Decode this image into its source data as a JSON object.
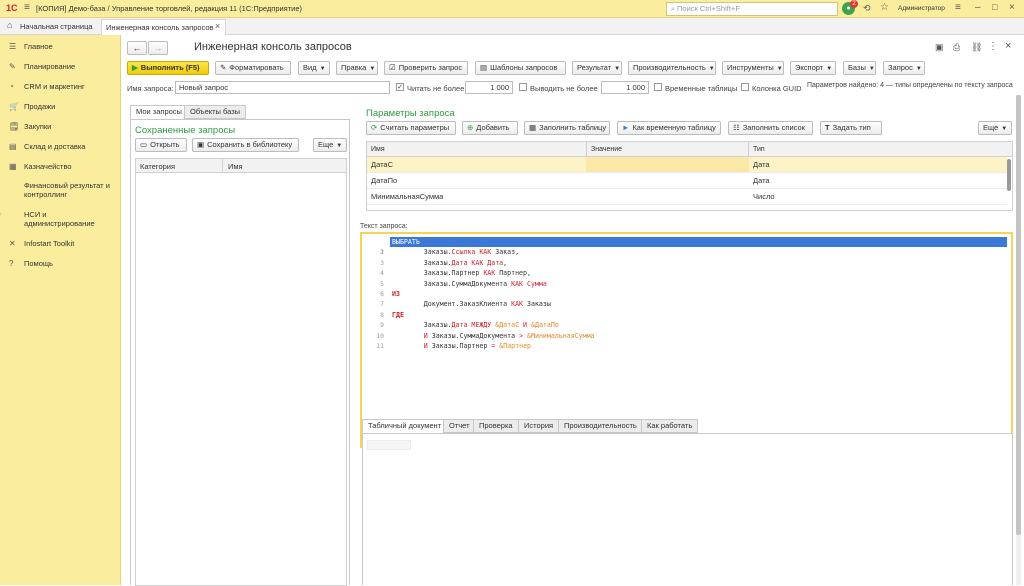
{
  "titlebar": {
    "logo": "1С",
    "title": "[КОПИЯ] Демо-база / Управление торговлей, редакция 11  (1С:Предприятие)",
    "search_placeholder": "Поиск Ctrl+Shift+F",
    "notification_count": "2",
    "user": "Администратор"
  },
  "tabs": {
    "home": "Начальная страница",
    "current": "Инженерная консоль запросов",
    "close": "×"
  },
  "sidebar": {
    "items": [
      {
        "icon": "☰",
        "label": "Главное"
      },
      {
        "icon": "✎",
        "label": "Планирование"
      },
      {
        "icon": "◔",
        "label": "CRM и маркетинг"
      },
      {
        "icon": "🛒",
        "label": "Продажи"
      },
      {
        "icon": "🗒",
        "label": "Закупки"
      },
      {
        "icon": "▤",
        "label": "Склад и доставка"
      },
      {
        "icon": "▦",
        "label": "Казначейство"
      },
      {
        "icon": "▮",
        "label": "Финансовый результат и контроллинг"
      },
      {
        "icon": "⚙",
        "label": "НСИ и администрирование"
      },
      {
        "icon": "✕",
        "label": "Infostart Toolkit"
      },
      {
        "icon": "?",
        "label": "Помощь"
      }
    ]
  },
  "page": {
    "title": "Инженерная консоль запросов",
    "back": "←",
    "forward": "→",
    "more": "⋮",
    "close": "×"
  },
  "toolbar": {
    "run": "Выполнить (F5)",
    "format": "Форматировать",
    "vid": "Вид",
    "pravka": "Правка",
    "check": "Проверить запрос",
    "templates": "Шаблоны запросов",
    "result": "Результат",
    "performance": "Производительность",
    "tools": "Инструменты",
    "export": "Экспорт",
    "bases": "Базы",
    "query": "Запрос"
  },
  "options": {
    "name_label": "Имя запроса:",
    "name_value": "Новый запрос",
    "read_limit_label": "Читать не более",
    "read_limit_value": "1 000",
    "output_limit_label": "Выводить не более",
    "output_limit_value": "1 000",
    "temp_tables_label": "Временные таблицы",
    "guid_label": "Колонка GUID",
    "params_info": "Параметров найдено: 4 — типы определены по тексту запроса"
  },
  "left_panel": {
    "tab_my": "Мои запросы",
    "tab_objects": "Объекты базы",
    "saved_title": "Сохраненные запросы",
    "open": "Открыть",
    "save_lib": "Сохранить в библиотеку",
    "more": "Еще",
    "col_category": "Категория",
    "col_name": "Имя"
  },
  "params": {
    "title": "Параметры запроса",
    "count": "Считать параметры",
    "add": "Добавить",
    "fill_table": "Заполнить таблицу",
    "as_temp": "Как временную таблицу",
    "fill_list": "Заполнить список",
    "set_type": "Задать тип",
    "more": "Еще",
    "col_name": "Имя",
    "col_value": "Значение",
    "col_type": "Тип",
    "rows": [
      {
        "name": "ДатаС",
        "value": "",
        "type": "Дата"
      },
      {
        "name": "ДатаПо",
        "value": "",
        "type": "Дата"
      },
      {
        "name": "МинимальнаяСумма",
        "value": "",
        "type": "Число"
      }
    ]
  },
  "editor": {
    "label": "Текст запроса:",
    "lines": [
      {
        "n": "1",
        "t": "ВЫБРАТЬ"
      },
      {
        "n": "2",
        "t": "        Заказы.Ссылка КАК Заказ,"
      },
      {
        "n": "3",
        "t": "        Заказы.Дата КАК Дата,"
      },
      {
        "n": "4",
        "t": "        Заказы.Партнер КАК Партнер,"
      },
      {
        "n": "5",
        "t": "        Заказы.СуммаДокумента КАК Сумма"
      },
      {
        "n": "6",
        "t": "ИЗ"
      },
      {
        "n": "7",
        "t": "        Документ.ЗаказКлиента КАК Заказы"
      },
      {
        "n": "8",
        "t": "ГДЕ"
      },
      {
        "n": "9",
        "t": "        Заказы.Дата МЕЖДУ &ДатаС И &ДатаПо"
      },
      {
        "n": "10",
        "t": "        И Заказы.СуммаДокумента > &МинимальнаяСумма"
      },
      {
        "n": "11",
        "t": "        И Заказы.Партнер = &Партнер"
      }
    ]
  },
  "bottom_tabs": [
    "Табличный документ",
    "Отчет",
    "Проверка",
    "История",
    "Производительность",
    "Как работать"
  ],
  "colors": {
    "accent": "#fbed9e",
    "run_button": "#f5d90f",
    "link_green": "#2e9c3f",
    "selection": "#3b78d8"
  }
}
